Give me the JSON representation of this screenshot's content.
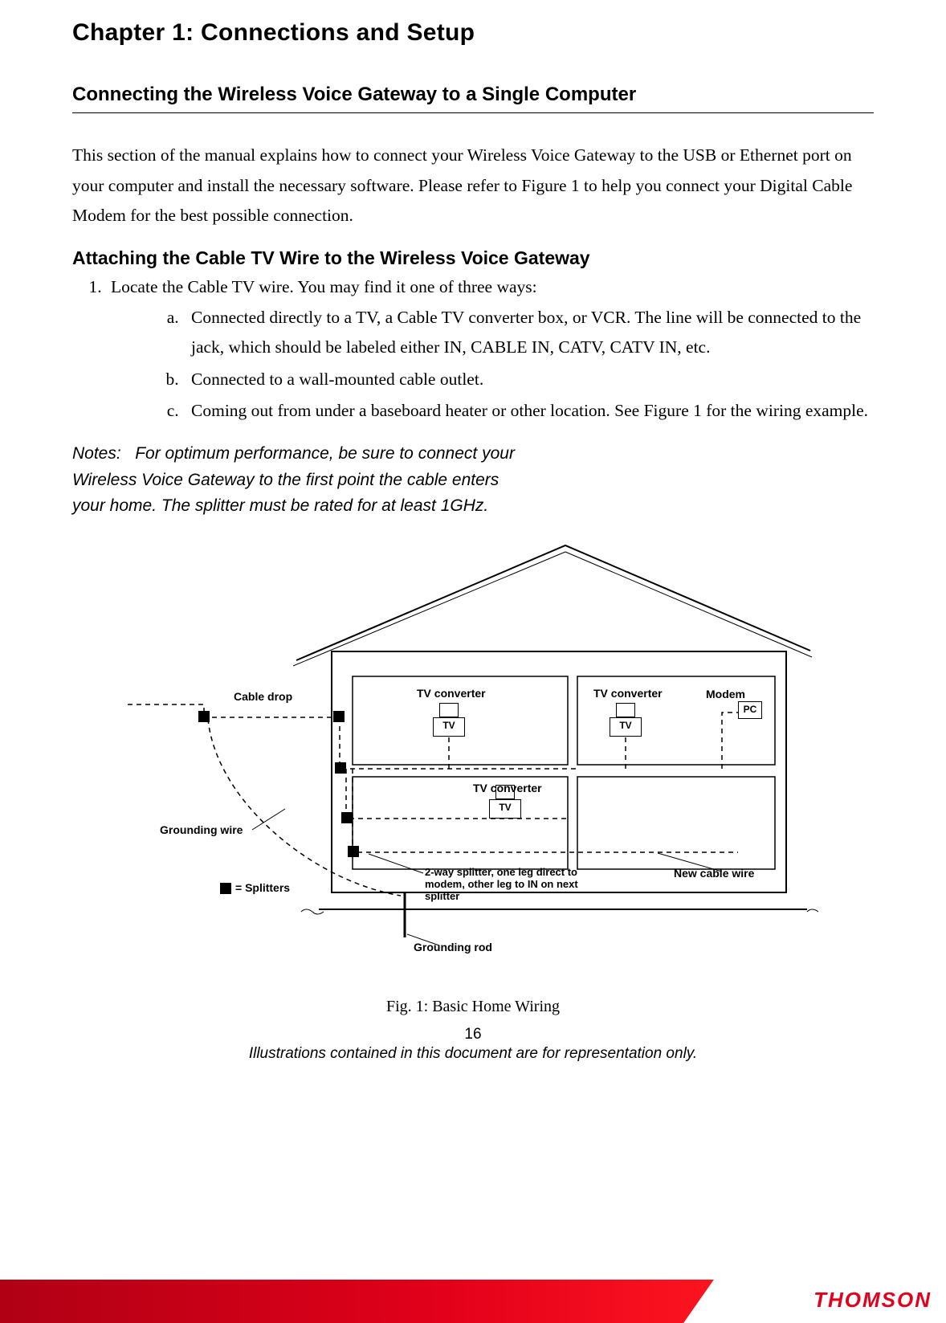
{
  "chapter_title": "Chapter 1: Connections and Setup",
  "section_title": "Connecting the Wireless Voice Gateway to a Single Computer",
  "intro_paragraph": "This section of the manual explains how to connect your Wireless Voice Gateway to the USB or Ethernet port on your computer and install the necessary software.    Please refer to Figure 1 to help you connect your Digital Cable Modem for the best possible connection.",
  "subsection_title": "Attaching the Cable TV Wire to the Wireless Voice Gateway",
  "step_1_intro": "Locate the Cable TV wire. You may find it one of three ways:",
  "step_1_items": {
    "a": "Connected directly to a TV, a Cable TV converter box, or VCR. The line will be connected to the jack, which should be labeled either IN, CABLE IN, CATV, CATV IN, etc.",
    "b": "Connected to a wall-mounted cable outlet.",
    "c": "Coming out from under a baseboard heater or other location. See Figure 1 for the wiring example."
  },
  "notes_label": "Notes:",
  "notes_text": "For optimum performance, be sure to connect your Wireless Voice Gateway to the first point the cable enters your home. The splitter must be rated for at least 1GHz.",
  "figure": {
    "labels": {
      "cable_drop": "Cable drop",
      "tv_converter_1": "TV converter",
      "tv_converter_2": "TV converter",
      "tv_converter_3": "TV converter",
      "modem": "Modem",
      "pc": "PC",
      "tv_1": "TV",
      "tv_2": "TV",
      "tv_3": "TV",
      "grounding_wire": "Grounding wire",
      "splitters_legend": "= Splitters",
      "splitter_note": "2-way splitter, one leg direct to modem, other leg to IN on next splitter",
      "new_cable_wire": "New cable wire",
      "grounding_rod": "Grounding rod"
    },
    "caption": "Fig. 1:    Basic Home Wiring"
  },
  "page_number": "16",
  "footer_note": "Illustrations contained in this document are for representation only.",
  "brand": "THOMSON"
}
